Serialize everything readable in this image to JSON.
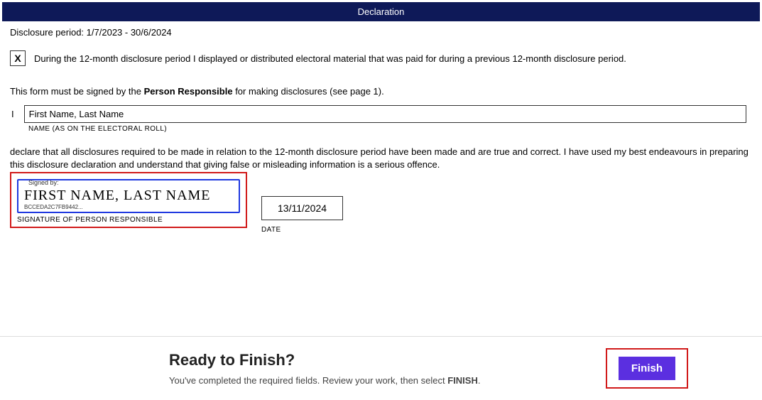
{
  "header": {
    "title": "Declaration"
  },
  "disclosure": {
    "label": "Disclosure period:",
    "period": "1/7/2023 - 30/6/2024"
  },
  "checkbox": {
    "mark": "X",
    "text": "During the 12-month disclosure period I displayed or distributed electoral material that was paid for during a previous 12-month disclosure period."
  },
  "sign_instruction": {
    "prefix": "This form must be signed by the ",
    "bold": "Person Responsible",
    "suffix": " for making disclosures (see page 1)."
  },
  "name": {
    "prefix": "I",
    "value": "First Name, Last Name",
    "caption": "NAME (AS ON THE ELECTORAL ROLL)"
  },
  "declare": "declare that all disclosures required to be made in relation to the 12-month disclosure period have been made and are true and correct. I have used my best endeavours in preparing this disclosure declaration and understand that giving false or misleading information is a serious offence.",
  "signature": {
    "signed_by_label": "Signed by:",
    "script_text": "FIRST NAME, LAST NAME",
    "hash": "BCCEDA2C7FB9442...",
    "caption": "SIGNATURE OF PERSON RESPONSIBLE"
  },
  "date": {
    "value": "13/11/2024",
    "caption": "DATE"
  },
  "footer": {
    "title": "Ready to Finish?",
    "subtitle_prefix": "You've completed the required fields. Review your work, then select ",
    "subtitle_bold": "FINISH",
    "subtitle_suffix": ".",
    "button": "Finish"
  }
}
